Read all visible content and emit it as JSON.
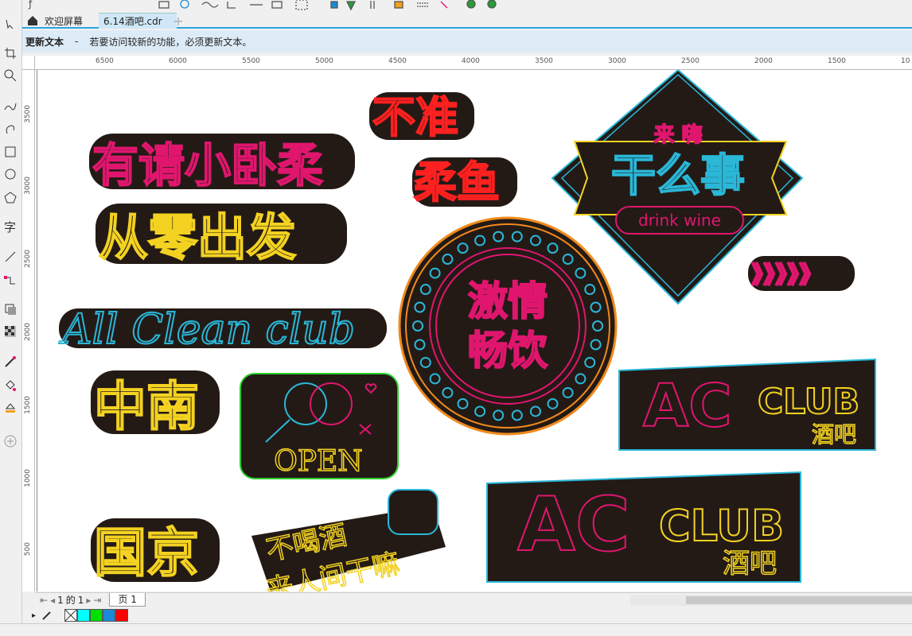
{
  "tabs": {
    "welcome": "欢迎屏幕",
    "document": "6.14酒吧.cdr",
    "add": "+"
  },
  "notice": {
    "title": "更新文本",
    "separator": "-",
    "message": "若要访问较新的功能，必须更新文本。"
  },
  "ruler_h": [
    "6500",
    "6000",
    "5500",
    "5000",
    "4500",
    "4000",
    "3500",
    "3000",
    "2500",
    "2000",
    "1500",
    "10"
  ],
  "ruler_v": [
    "3500",
    "3000",
    "2500",
    "2000",
    "1500",
    "1000",
    "500"
  ],
  "artwork": {
    "sticker_1": "有请小卧柔",
    "sticker_2": "从零出发",
    "sticker_3": "All Clean club",
    "sticker_4": "中南",
    "sticker_5": "国京",
    "sticker_6": "不准",
    "sticker_7": "柔鱼",
    "circle_top": "激情",
    "circle_bottom": "畅饮",
    "diamond_small": "来 嗨",
    "diamond_main": "干么事",
    "diamond_sub": "drink wine",
    "arrows": "》》》》》",
    "open_sign": "OPEN",
    "speech_1": "不喝酒",
    "speech_2": "来人间干嘛",
    "club_1_ac": "AC",
    "club_1_club": "CLUB",
    "club_1_sub": "酒吧",
    "club_2_ac": "AC",
    "club_2_club": "CLUB",
    "club_2_sub": "酒吧"
  },
  "page_nav": {
    "current": "1",
    "of": "的",
    "total": "1",
    "page_tab": "页 1"
  },
  "palette": [
    "none",
    "#00ffff",
    "#00e000",
    "#1a8ad8",
    "#ff0000"
  ],
  "colors": {
    "accent": "#29a5e0",
    "notice_bg": "#ddebf7",
    "sticker_bg": "#231a16",
    "neon_pink": "#e0166e",
    "neon_yellow": "#f3d221",
    "neon_cyan": "#2ab7d8",
    "neon_orange": "#f08a1c",
    "neon_green": "#2ad02a"
  }
}
